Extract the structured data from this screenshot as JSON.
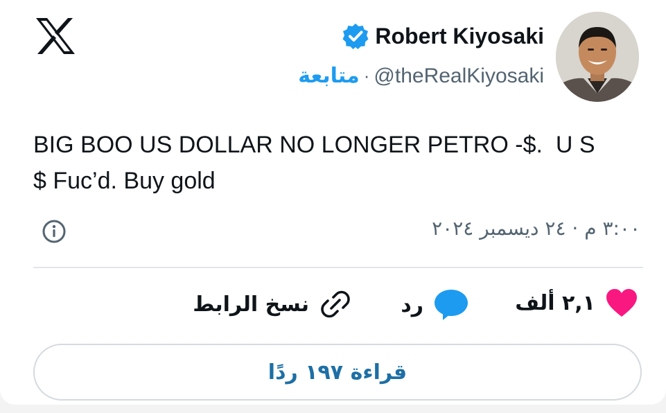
{
  "author": {
    "display_name": "Robert Kiyosaki",
    "handle": "@theRealKiyosaki",
    "separator": "·",
    "follow_label": "متابعة",
    "verified": true
  },
  "tweet": {
    "text": "BIG BOO US DOLLAR NO LONGER PETRO -$.  U S\n$ Fuc’d. Buy gold",
    "timestamp": "٣:٠٠ م · ٢٤ ديسمبر ٢٠٢٤"
  },
  "actions": {
    "like_count": "٢,١ ألف",
    "reply_label": "رد",
    "copy_link_label": "نسخ الرابط"
  },
  "read_replies_label": "قراءة ١٩٧ ردًا",
  "icons": {
    "logo": "x-logo-icon",
    "verified": "verified-badge-icon",
    "info": "info-icon",
    "like": "heart-icon",
    "reply": "reply-bubble-icon",
    "copy": "link-icon"
  },
  "colors": {
    "accent": "#1d9bf0",
    "heart": "#f91880",
    "text": "#0f1419",
    "muted": "#536471"
  }
}
